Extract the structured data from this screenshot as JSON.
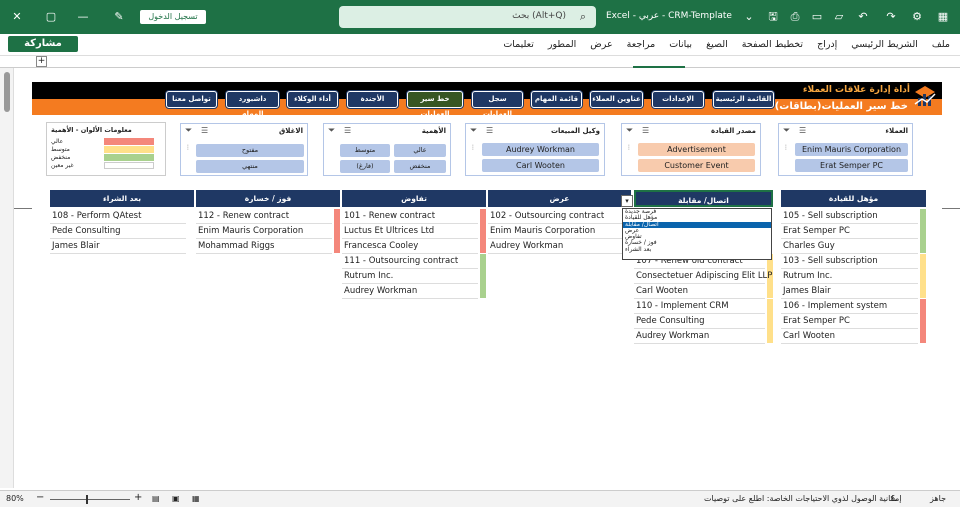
{
  "titlebar": {
    "save_icon": "save-icon",
    "signin_label": "تسجيل الدخول",
    "search_text": "بحث (Alt+Q)",
    "app_title": "Excel - عربي - CRM-Template"
  },
  "menubar": {
    "share_label": "مشاركة",
    "menus": [
      "ملف",
      "الشريط الرئيسي",
      "إدراج",
      "تخطيط الصفحة",
      "الصيغ",
      "بيانات",
      "مراجعة",
      "عرض",
      "المطور",
      "تعليمات"
    ]
  },
  "banner": {
    "title_small": "أداة إدارة علاقات العملاء",
    "title_main": "خط سير العمليات(بطاقات)"
  },
  "nav": [
    "القائمة الرئيسية",
    "الإعدادات",
    "عناوين العملاء",
    "قائمة المهام",
    "سجل العمليات",
    "خط سير العمليات",
    "الأجندة",
    "أداء الوكلاء",
    "داشبورد المهام",
    "تواصل معنا"
  ],
  "slicers": {
    "customers": {
      "title": "العملاء",
      "items": [
        "Enim Mauris Corporation",
        "Erat Semper PC"
      ]
    },
    "lead_source": {
      "title": "مصدر القيادة",
      "items": [
        "Advertisement",
        "Customer Event"
      ]
    },
    "sales_agent": {
      "title": "وكيل المبيعات",
      "items": [
        "Audrey Workman",
        "Carl Wooten"
      ]
    },
    "priority": {
      "title": "الأهمية",
      "items": [
        "عالي",
        "متوسط",
        "منخفض",
        "(فارغ)"
      ]
    },
    "closing": {
      "title": "الاغلاق",
      "items": [
        "مفتوح",
        "منتهي"
      ]
    }
  },
  "legend": {
    "title": "معلومات الألوان - الأهمية",
    "rows": [
      {
        "label": "عالي",
        "color": "#f4877b"
      },
      {
        "label": "متوسط",
        "color": "#ffe08a"
      },
      {
        "label": "منخفض",
        "color": "#a9d18e"
      },
      {
        "label": "غير معين",
        "color": "#ffffff"
      }
    ]
  },
  "columns": [
    "مؤهل للقيادة",
    "اتصال/ مقابلة",
    "عرض",
    "تفاوض",
    "فوز / خسارة",
    "بعد الشراء"
  ],
  "cards": {
    "c0": [
      {
        "lines": [
          "105 - Sell subscription",
          "Erat Semper PC",
          "Charles Guy"
        ],
        "color": "#a9d18e"
      },
      {
        "lines": [
          "103 - Sell subscription",
          "Rutrum Inc.",
          "James Blair"
        ],
        "color": "#ffe08a"
      },
      {
        "lines": [
          "106 - Implement system",
          "Erat Semper PC",
          "Carl Wooten"
        ],
        "color": "#f4877b"
      }
    ],
    "c1": [
      {
        "lines": [
          "107 - Renew old contract",
          "Consectetuer Adipiscing Elit LLP",
          "Carl Wooten"
        ],
        "color": "#ffe08a"
      },
      {
        "lines": [
          "110 - Implement CRM",
          "Pede Consulting",
          "Audrey Workman"
        ],
        "color": "#ffe08a"
      }
    ],
    "c2": [
      {
        "lines": [
          "102 - Outsourcing contract",
          "Enim Mauris Corporation",
          "Audrey Workman"
        ],
        "color": "#ffe08a"
      }
    ],
    "c3": [
      {
        "lines": [
          "101 - Renew contract",
          "Luctus Et Ultrices Ltd",
          "Francesca Cooley"
        ],
        "color": "#f4877b"
      },
      {
        "lines": [
          "111 - Outsourcing contract",
          "Rutrum Inc.",
          "Audrey Workman"
        ],
        "color": "#a9d18e"
      }
    ],
    "c4": [
      {
        "lines": [
          "112 - Renew contract",
          "Enim Mauris Corporation",
          "Mohammad Riggs"
        ],
        "color": "#f4877b"
      }
    ],
    "c5": [
      {
        "lines": [
          "108 - Perform QAtest",
          "Pede Consulting",
          "James Blair"
        ],
        "color": "#ffffff"
      }
    ]
  },
  "dropdown": [
    "فرصة جديدة",
    "مؤهل للقيادة",
    "اتصال/ مقابلة",
    "عرض",
    "تفاوض",
    "فوز / خسارة",
    "بعد الشراء"
  ],
  "dropdown_selected": 2,
  "statusbar": {
    "zoom": "80%",
    "accessibility": "إمكانية الوصول لذوي الاحتياجات الخاصة: اطلع على توصيات",
    "ready": "جاهز"
  }
}
